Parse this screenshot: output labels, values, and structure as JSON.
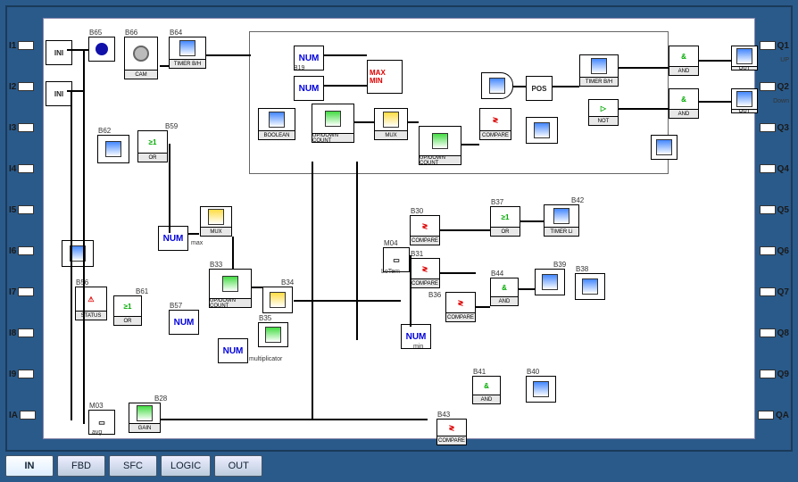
{
  "inputs": [
    "I1",
    "I2",
    "I3",
    "I4",
    "I5",
    "I6",
    "I7",
    "I8",
    "I9",
    "IA"
  ],
  "outputs": [
    "Q1",
    "Q2",
    "Q3",
    "Q4",
    "Q5",
    "Q6",
    "Q7",
    "Q8",
    "Q9",
    "QA"
  ],
  "out_sub": {
    "q1": "UP",
    "q2": "Down"
  },
  "tabs": [
    "IN",
    "FBD",
    "SFC",
    "LOGIC",
    "OUT"
  ],
  "active_tab": 0,
  "labels": {
    "INI": "INI",
    "NUM": "NUM",
    "OR": "OR",
    "AND": "AND",
    "NOT": "NOT",
    "OUT": "OUT",
    "CAM": "CAM",
    "GAIN": "GAIN",
    "STATUS": "STATUS",
    "MUX": "MUX",
    "BOOLEAN": "BOOLEAN",
    "UPDOWN": "UP/DOWN COUNT",
    "TIMER": "TIMER B/H",
    "TIMER_LI": "TIMER Li",
    "COMPARE": "COMPARE",
    "MAXMIN": "MAX MIN",
    "POS": "POS",
    "avg": "avg",
    "multiplicator": "multiplicator",
    "max": "max",
    "min": "min",
    "LoTem": "LoTem"
  },
  "blocks": {
    "B19": "B19",
    "B28": "B28",
    "B30": "B30",
    "B31": "B31",
    "B33": "B33",
    "B34": "B34",
    "B35": "B35",
    "B36": "B36",
    "B37": "B37",
    "B38": "B38",
    "B39": "B39",
    "B40": "B40",
    "B41": "B41",
    "B42": "B42",
    "B43": "B43",
    "B44": "B44",
    "B56": "B56",
    "B57": "B57",
    "B59": "B59",
    "B61": "B61",
    "B62": "B62",
    "B64": "B64",
    "B65": "B65",
    "B66": "B66",
    "M03": "M03",
    "M04": "M04"
  }
}
